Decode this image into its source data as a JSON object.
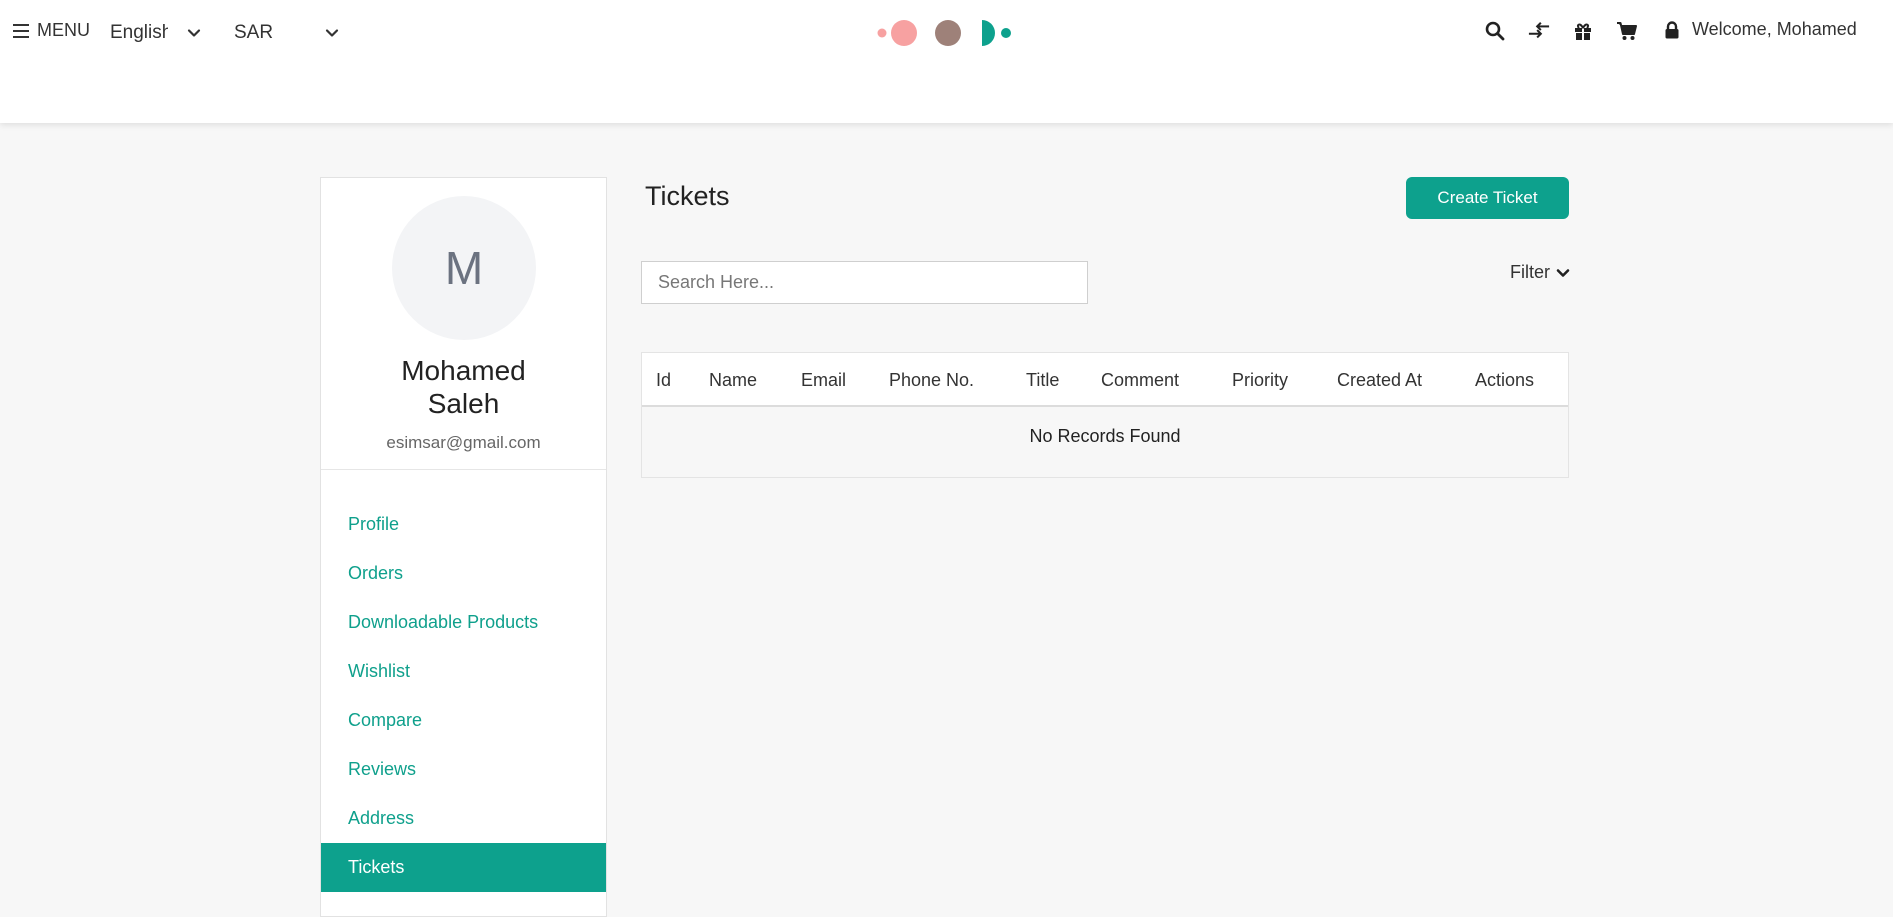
{
  "header": {
    "menu_label": "MENU",
    "language": "English",
    "currency": "SAR",
    "welcome": "Welcome, Mohamed",
    "icons": [
      "search-icon",
      "compare-icon",
      "gift-icon",
      "cart-icon",
      "lock-icon"
    ],
    "logo_colors": [
      "#f7a1a1",
      "#9e8179",
      "#0da18d"
    ]
  },
  "sidebar": {
    "avatar_initial": "M",
    "user_name": "Mohamed Saleh",
    "email": "esimsar@gmail.com",
    "items": [
      {
        "label": "Profile"
      },
      {
        "label": "Orders"
      },
      {
        "label": "Downloadable Products"
      },
      {
        "label": "Wishlist"
      },
      {
        "label": "Compare"
      },
      {
        "label": "Reviews"
      },
      {
        "label": "Address"
      },
      {
        "label": "Tickets",
        "active": true
      }
    ]
  },
  "main": {
    "title": "Tickets",
    "create_button": "Create Ticket",
    "search_placeholder": "Search Here...",
    "filter_label": "Filter",
    "columns": [
      "Id",
      "Name",
      "Email",
      "Phone No.",
      "Title",
      "Comment",
      "Priority",
      "Created At",
      "Actions"
    ],
    "empty_message": "No Records Found"
  },
  "colors": {
    "accent": "#0da18d",
    "link": "#0fa08c"
  }
}
